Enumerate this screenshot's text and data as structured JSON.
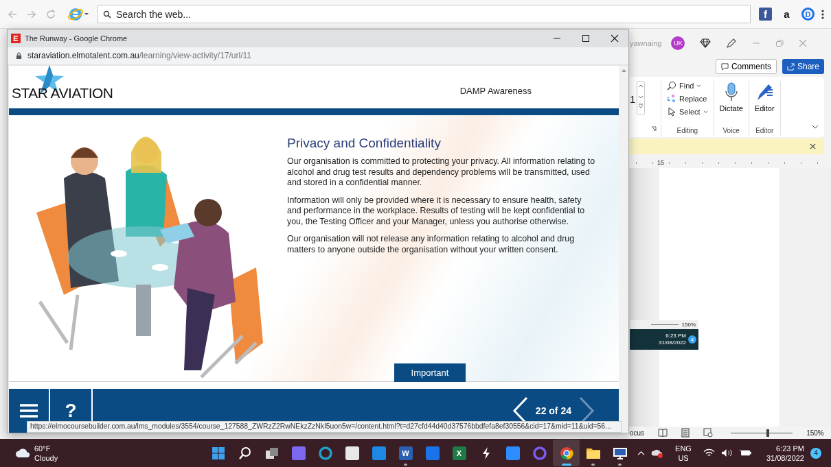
{
  "browser_toolbar": {
    "search": {
      "placeholder": "Search the web..."
    },
    "extensions": [
      {
        "kind": "facebook",
        "glyph": "f"
      },
      {
        "kind": "amazon",
        "glyph": "a"
      },
      {
        "kind": "profile",
        "glyph": "D"
      }
    ]
  },
  "word_window": {
    "account": "yawnaing",
    "avatar": "UK",
    "comments": "Comments",
    "share": "Share",
    "font_size": "1",
    "editing_items": [
      {
        "kind": "find",
        "label": "Find",
        "has_menu": true
      },
      {
        "kind": "replace",
        "label": "Replace",
        "has_menu": false
      },
      {
        "kind": "select",
        "label": "Select",
        "has_menu": true
      }
    ],
    "groups": [
      {
        "kind": "editing",
        "label": "Editing"
      },
      {
        "kind": "voice",
        "label": "Voice",
        "button": "Dictate"
      },
      {
        "kind": "editor",
        "label": "Editor",
        "button": "Editor"
      }
    ],
    "ruler_number": "15",
    "embedded_capture": {
      "zoom": "150%",
      "time": "6:23 PM",
      "date": "31/08/2022",
      "badge": "4"
    },
    "status_bar": {
      "focus": "ocus",
      "zoom_slider": {
        "level": 0.6
      },
      "zoom": "150%"
    }
  },
  "popup": {
    "title": "The Runway - Google Chrome",
    "url_host": "staraviation.elmotalent.com.au",
    "url_path": "/learning/view-activity/17/url/11",
    "course": {
      "logo": "STAR AVIATION",
      "module": "DAMP Awareness",
      "heading": "Privacy and Confidentiality",
      "paragraphs": [
        "Our organisation is committed to protecting your privacy. All information relating to alcohol and drug test results and dependency problems will be transmitted, used and stored in a confidential manner.",
        "Information will only be provided where it is necessary to ensure health, safety and performance in the workplace. Results of testing will be kept confidential to you, the Testing Officer and your Manager, unless you authorise otherwise.",
        "Our organisation will not release any information relating to alcohol and drug matters to anyone outside the organisation without your written consent."
      ],
      "button": "Important",
      "nav": {
        "help": "?",
        "page": "22 of 24"
      }
    },
    "status_url": "https://elmocoursebuilder.com.au/lms_modules/3554/course_127588_ZWRzZ2RwNEkzZzNkI5uon5w=/content.html?t=d27cfd44d40d37576bbdfefa8ef30556&cid=17&mid=11&uid=56..."
  },
  "taskbar": {
    "weather": {
      "temp": "60°F",
      "condition": "Cloudy"
    },
    "apps": [
      {
        "kind": "start",
        "running": false,
        "selected": false
      },
      {
        "kind": "search",
        "running": false,
        "selected": false
      },
      {
        "kind": "taskview",
        "running": false,
        "selected": false
      },
      {
        "kind": "chat",
        "running": false,
        "selected": false
      },
      {
        "kind": "edge",
        "running": false,
        "selected": false
      },
      {
        "kind": "store",
        "running": false,
        "selected": false
      },
      {
        "kind": "mail",
        "running": false,
        "selected": false
      },
      {
        "kind": "word",
        "glyph": "W",
        "running": true,
        "selected": false
      },
      {
        "kind": "dropbox",
        "running": false,
        "selected": false
      },
      {
        "kind": "excel",
        "glyph": "X",
        "running": false,
        "selected": false
      },
      {
        "kind": "bolt",
        "running": false,
        "selected": false
      },
      {
        "kind": "zoom",
        "running": false,
        "selected": false
      },
      {
        "kind": "ring",
        "running": false,
        "selected": false
      },
      {
        "kind": "chrome",
        "running": true,
        "selected": true
      },
      {
        "kind": "folder",
        "running": true,
        "selected": false
      },
      {
        "kind": "monitor",
        "running": true,
        "selected": false
      }
    ],
    "tray": {
      "lang": "ENG",
      "region": "US",
      "time": "6:23 PM",
      "date": "31/08/2022",
      "badge": "4"
    }
  }
}
